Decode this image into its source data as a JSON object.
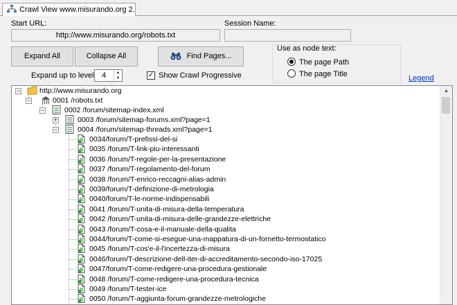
{
  "tab": {
    "title": "Crawl View www.misurando.org 2..."
  },
  "start_url": {
    "label": "Start URL:",
    "value": "http://www.misurando.org/robots.txt"
  },
  "session": {
    "label": "Session Name:",
    "value": ""
  },
  "buttons": {
    "expand_all": "Expand All",
    "collapse_all": "Collapse All",
    "find_pages": "Find Pages..."
  },
  "expand_level": {
    "label": "Expand up to level:",
    "value": "4"
  },
  "show_crawl": {
    "label": "Show Crawl Progressive",
    "checked": true
  },
  "node_text": {
    "title": "Use as node text:",
    "options": [
      {
        "label": "The page Path",
        "selected": true
      },
      {
        "label": "The page Title",
        "selected": false
      }
    ]
  },
  "legend": "Legend",
  "tree": {
    "root": "http://www.misurando.org",
    "robots": "0001 /robots.txt",
    "sitemap_index": "0002 /forum/sitemap-index.xml",
    "sitemap_forums": "0003 /forum/sitemap-forums.xml?page=1",
    "sitemap_threads": "0004 /forum/sitemap-threads.xml?page=1",
    "pages": [
      "0034/forum/T-prefissi-del-si",
      "0035 /forum/T-link-piu-interessanti",
      "0036 /forum/T-regole-per-la-presentazione",
      "0037 /forum/T-regolamento-del-forum",
      "0038 /forum/T-enrico-reccagni-alias-admin",
      "0039/forum/T-definizione-di-metrologia",
      "0040/forum/T-le-norme-indispensabili",
      "0041 /forum/T-unita-di-misura-della-temperatura",
      "0042 /forum/T-unita-di-misura-delle-grandezze-elettriche",
      "0043 /forum/T-cosa-e-il-manuale-della-qualita",
      "0044/forum/T-come-si-esegue-una-mappatura-di-un-fornetto-termostatico",
      "0045 /forum/T-cos'e-il-l'incertezza-di-misura",
      "0046/forum/T-descrizione-dell-iter-di-accreditamento-secondo-iso-17025",
      "0047/forum/T-come-redigere-una-procedura-gestionale",
      "0048 /forum/T-come-redigere-una-procedura-tecnica",
      "0049 /forum/T-tester-ice",
      "0050 /forum/T-aggiunta-forum-grandezze-metrologiche"
    ]
  }
}
